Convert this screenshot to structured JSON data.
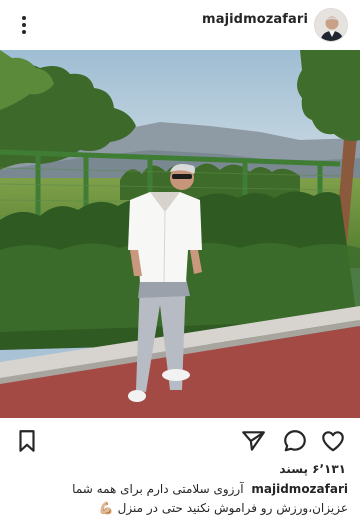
{
  "post": {
    "username": "majidmozafari",
    "likes": "۶٬۱۳۱ پسند",
    "caption": "آرزوی سلامتی دارم برای همه شما عزیزان،ورزش رو فراموش نکنید حتی در منزل 💪🏼",
    "image_alt": "Man in white shirt and grey trousers standing on a red path beside a green fenced field with trees and mountains in the background"
  },
  "icons": {
    "more": "more-options-icon",
    "like": "heart-icon",
    "comment": "comment-icon",
    "share": "send-icon",
    "save": "bookmark-icon"
  },
  "colors": {
    "text": "#262626",
    "background": "#ffffff",
    "border": "#dbdbdb"
  }
}
